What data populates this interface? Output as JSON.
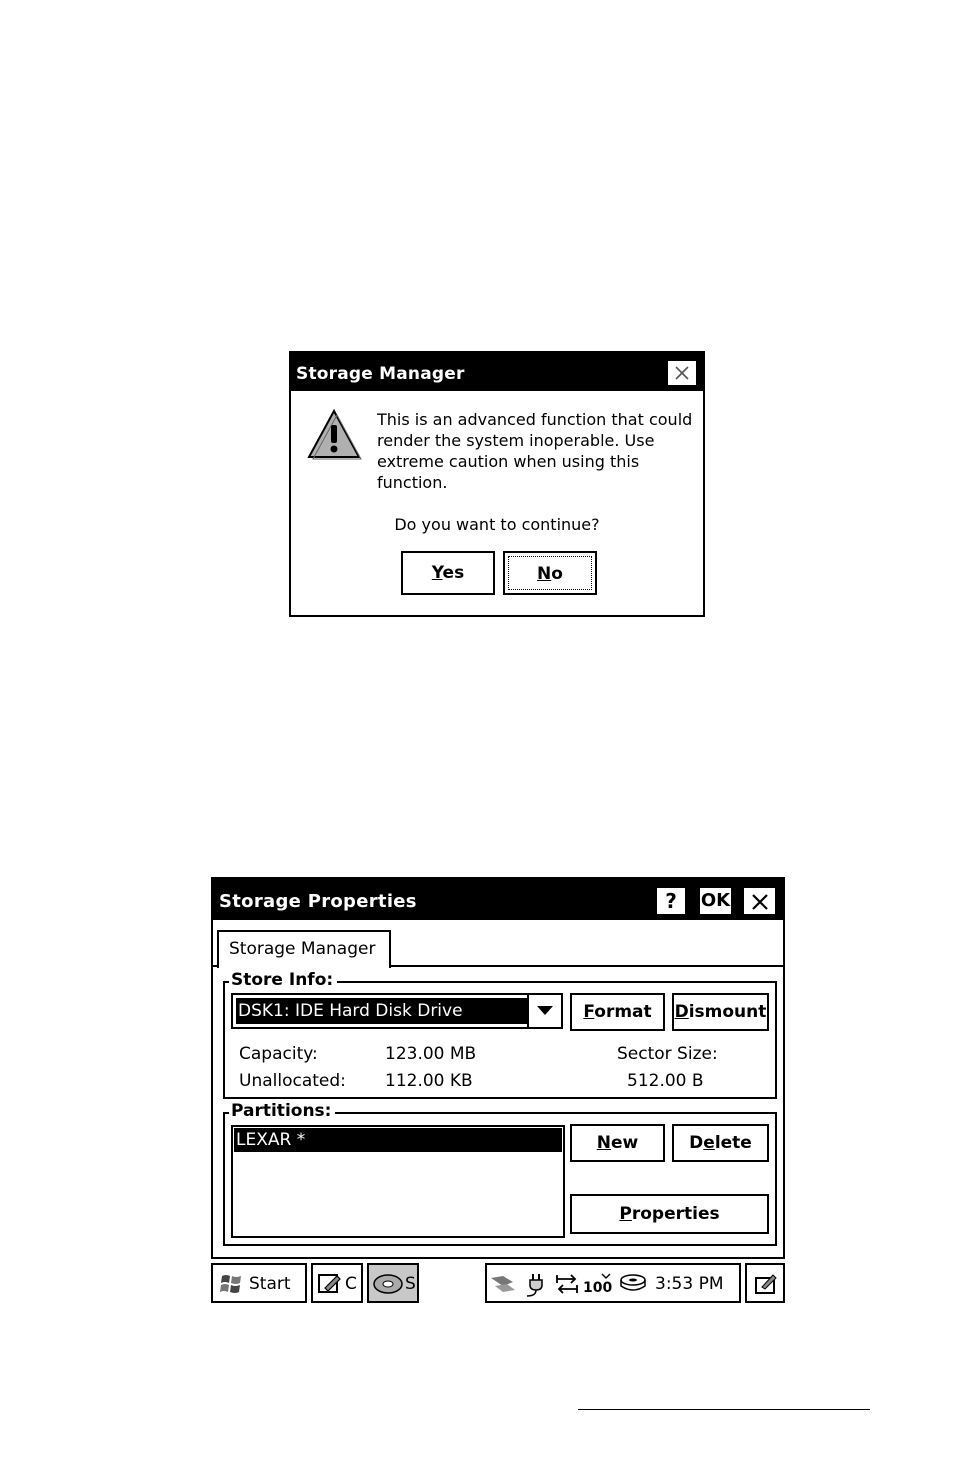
{
  "dialog": {
    "title": "Storage Manager",
    "close_icon": "close-icon",
    "warning_icon": "warning-icon",
    "message": "This is an advanced function that could render the system inoperable.  Use extreme caution when using this function.",
    "question": "Do you want to continue?",
    "yes_label_rest": "es",
    "yes_accel": "Y",
    "no_label_rest": "o",
    "no_accel": "N"
  },
  "window": {
    "title": "Storage Properties",
    "help_label": "?",
    "ok_label": "OK",
    "tab_label": "Storage Manager",
    "store_info": {
      "label": "Store Info:",
      "selected_store": "DSK1: IDE Hard Disk Drive",
      "format_accel": "F",
      "format_rest": "ormat",
      "dismount_accel": "D",
      "dismount_rest": "ismount",
      "capacity_label": "Capacity:",
      "capacity_value": "123.00 MB",
      "unallocated_label": "Unallocated:",
      "unallocated_value": "112.00 KB",
      "sector_size_label": "Sector Size:",
      "sector_size_value": "512.00 B"
    },
    "partitions": {
      "label": "Partitions:",
      "items": [
        "LEXAR *"
      ],
      "new_accel": "N",
      "new_rest": "ew",
      "delete_pre": "D",
      "delete_accel": "e",
      "delete_rest": "lete",
      "properties_accel": "P",
      "properties_rest": "roperties"
    }
  },
  "taskbar": {
    "start_label": "Start",
    "app1_label": "C",
    "app2_label": "S",
    "clock": "3:53 PM",
    "tray_icons": [
      "network-icon",
      "power-plug-icon",
      "sync-icon",
      "signal-100-icon",
      "disk-icon"
    ]
  }
}
